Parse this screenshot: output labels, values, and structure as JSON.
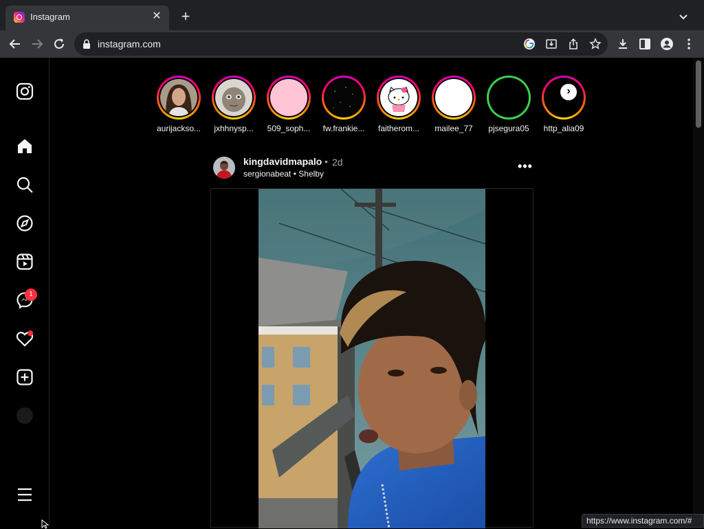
{
  "browser": {
    "tab_title": "Instagram",
    "tab_close": "✕",
    "new_tab": "+",
    "url": "instagram.com",
    "status_url": "https://www.instagram.com/#"
  },
  "sidebar": {
    "items": [
      {
        "name": "instagram-logo-icon"
      },
      {
        "name": "home-icon"
      },
      {
        "name": "search-icon"
      },
      {
        "name": "explore-icon"
      },
      {
        "name": "reels-icon"
      },
      {
        "name": "messenger-icon"
      },
      {
        "name": "heart-icon"
      },
      {
        "name": "create-icon"
      },
      {
        "name": "profile-avatar"
      },
      {
        "name": "menu-icon"
      }
    ],
    "messages_badge": "1"
  },
  "stories": [
    {
      "username": "aurijackso...",
      "ring": "gradient"
    },
    {
      "username": "jxhhnysp...",
      "ring": "gradient"
    },
    {
      "username": "509_soph...",
      "ring": "gradient"
    },
    {
      "username": "fw.frankie...",
      "ring": "gradient"
    },
    {
      "username": "faitherom...",
      "ring": "gradient"
    },
    {
      "username": "mailee_77",
      "ring": "gradient"
    },
    {
      "username": "pjsegura05",
      "ring": "close-friends"
    },
    {
      "username": "http_alia09",
      "ring": "gradient"
    }
  ],
  "stories_next": "›",
  "post": {
    "username": "kingdavidmapalo",
    "separator": "•",
    "time": "2d",
    "audio_artist": "sergionabeat",
    "audio_sep": "•",
    "audio_title": "Shelby",
    "more": "•••"
  },
  "colors": {
    "background": "#000000",
    "notification": "#ff3040",
    "close_friends_ring": "#3ccf4e"
  }
}
